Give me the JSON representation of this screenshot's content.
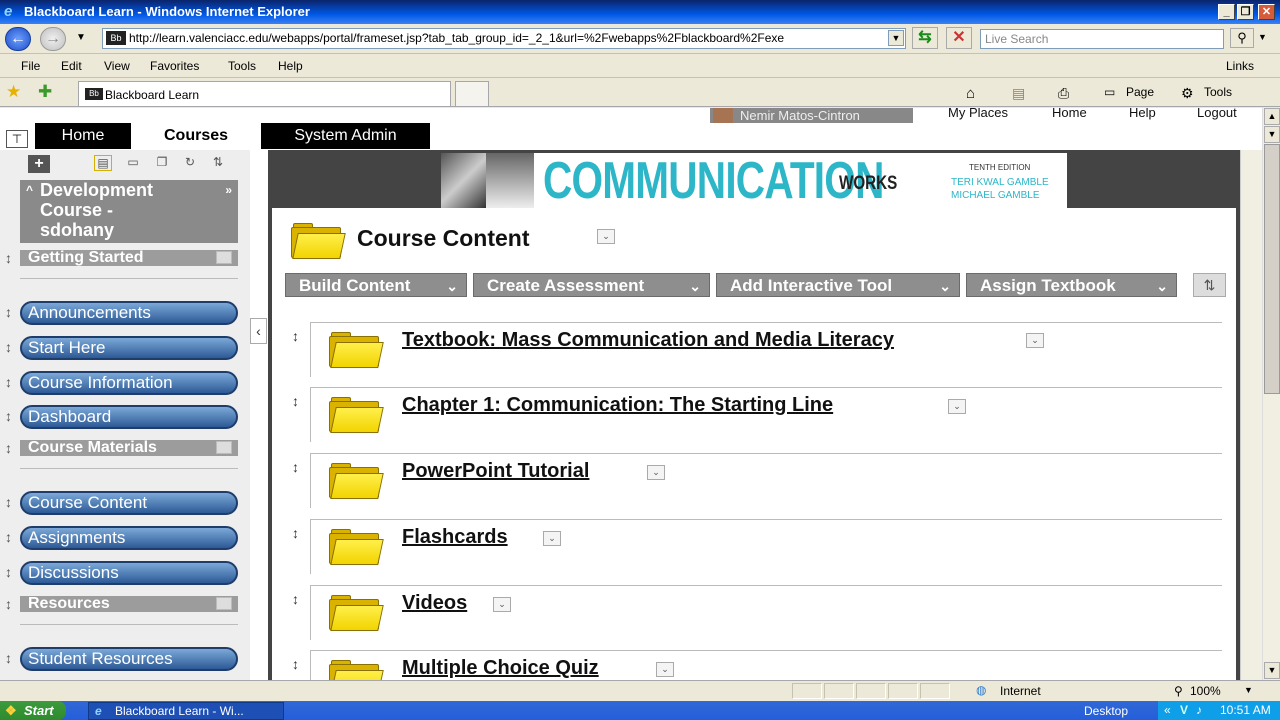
{
  "window": {
    "title": "Blackboard Learn - Windows Internet Explorer"
  },
  "addressbar": {
    "url": "http://learn.valenciacc.edu/webapps/portal/frameset.jsp?tab_tab_group_id=_2_1&url=%2Fwebapps%2Fblackboard%2Fexe",
    "search_placeholder": "Live Search"
  },
  "menubar": {
    "items": [
      "File",
      "Edit",
      "View",
      "Favorites",
      "Tools",
      "Help"
    ],
    "links": "Links"
  },
  "favbar": {
    "tab_title": "Blackboard Learn",
    "page_label": "Page",
    "tools_label": "Tools"
  },
  "bb": {
    "user": "Nemir Matos-Cintron",
    "util_links": [
      "My Places",
      "Home",
      "Help",
      "Logout"
    ],
    "tabs": [
      "Home",
      "Courses",
      "System Admin"
    ],
    "course_title_lines": [
      "Development",
      "Course -",
      "sdohany"
    ],
    "menu": {
      "getting_started": "Getting Started",
      "announcements": "Announcements",
      "start_here": "Start Here",
      "course_information": "Course Information",
      "dashboard": "Dashboard",
      "course_materials": "Course Materials",
      "course_content": "Course Content",
      "assignments": "Assignments",
      "discussions": "Discussions",
      "resources": "Resources",
      "student_resources": "Student Resources"
    },
    "banner": {
      "title": "COMMUNICATION",
      "subtitle": "WORKS",
      "edition": "TENTH EDITION",
      "author1": "TERI KWAL GAMBLE",
      "author2": "MICHAEL GAMBLE"
    },
    "page_title": "Course Content",
    "actions": [
      "Build Content",
      "Create Assessment",
      "Add Interactive Tool",
      "Assign Textbook"
    ],
    "items": [
      "Textbook: Mass Communication and Media Literacy",
      "Chapter 1: Communication: The Starting Line",
      "PowerPoint Tutorial",
      "Flashcards",
      "Videos",
      "Multiple Choice Quiz"
    ]
  },
  "statusbar": {
    "zone": "Internet",
    "zoom": "100%"
  },
  "taskbar": {
    "start": "Start",
    "task": "Blackboard Learn - Wi...",
    "desktop": "Desktop",
    "time": "10:51 AM"
  }
}
